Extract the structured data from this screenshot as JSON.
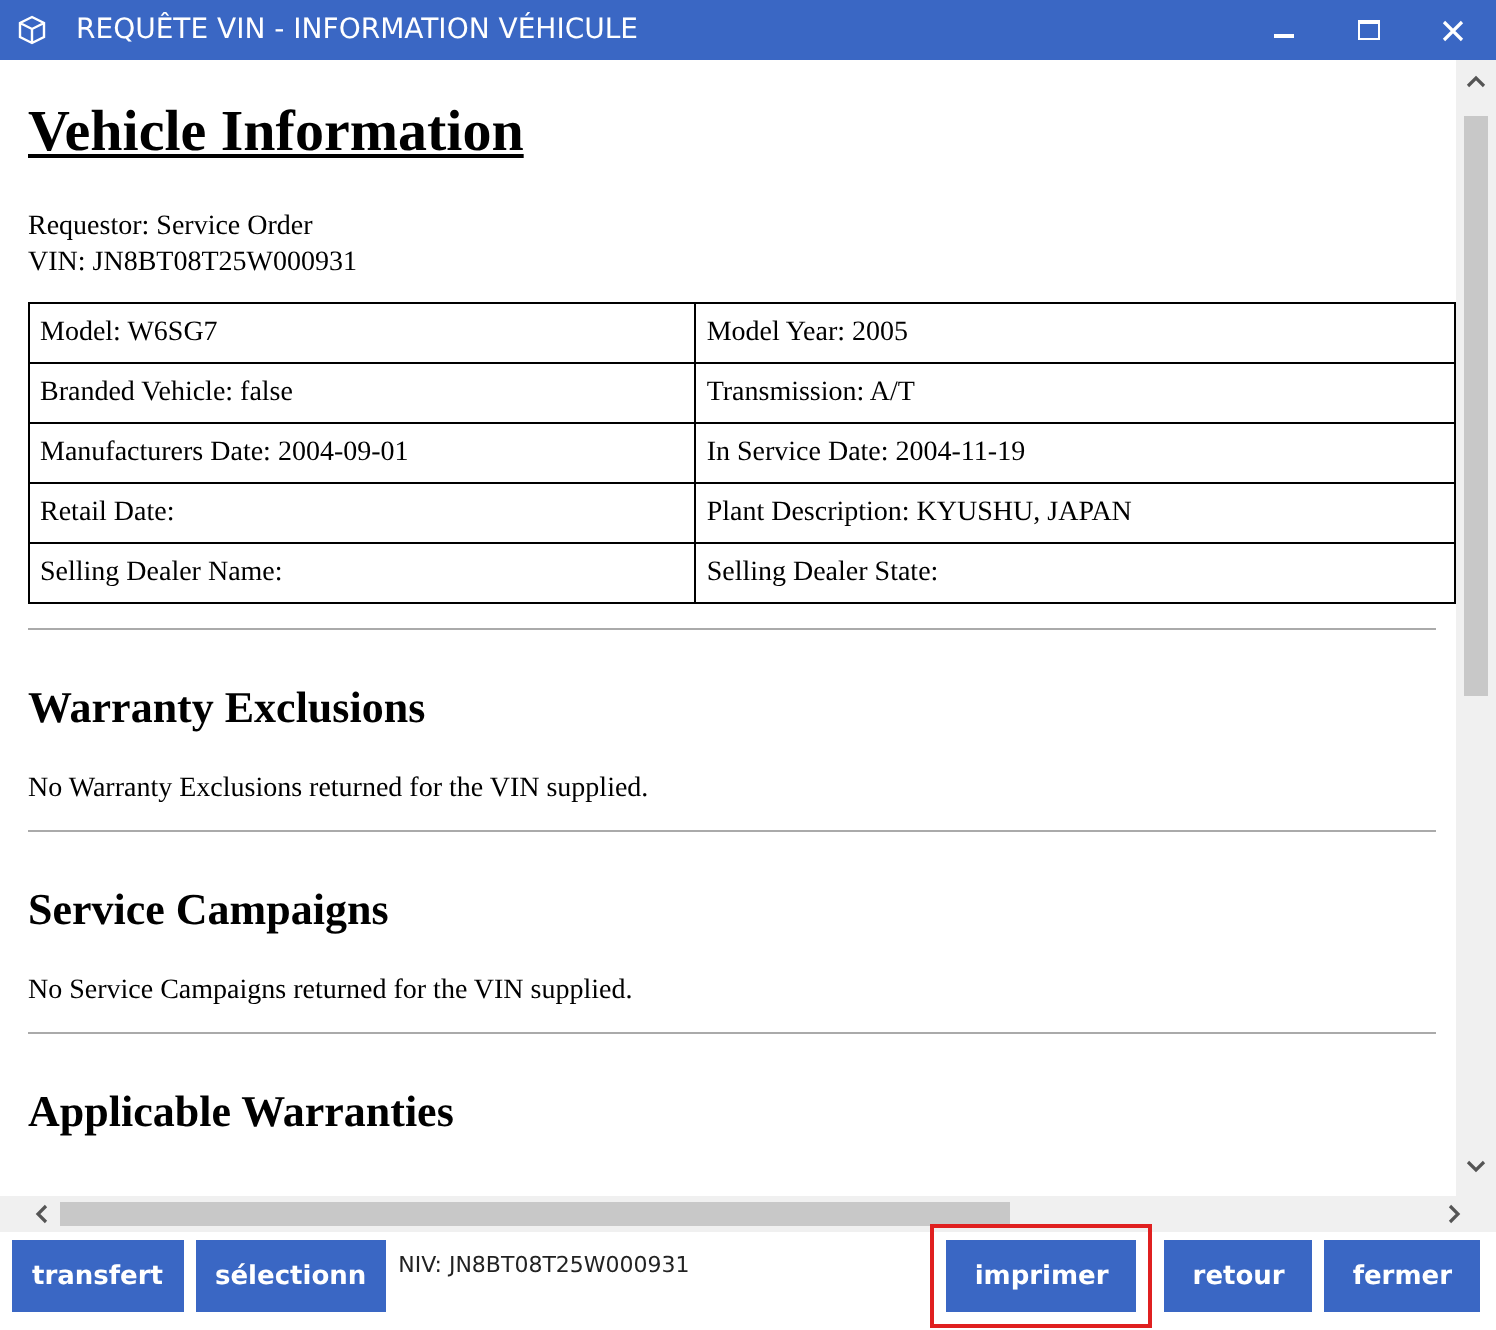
{
  "window": {
    "title": "REQUÊTE VIN - INFORMATION VÉHICULE"
  },
  "document": {
    "title": "Vehicle Information",
    "meta": [
      "Requestor: Service Order",
      "VIN: JN8BT08T25W000931"
    ],
    "table": {
      "rows": [
        [
          "Model: W6SG7",
          "Model Year: 2005"
        ],
        [
          "Branded Vehicle: false",
          "Transmission: A/T"
        ],
        [
          "Manufacturers Date: 2004-09-01",
          "In Service Date: 2004-11-19"
        ],
        [
          "Retail Date:",
          "Plant Description: KYUSHU, JAPAN"
        ],
        [
          "Selling Dealer Name:",
          "Selling Dealer State:"
        ]
      ]
    },
    "sections": [
      {
        "heading": "Warranty Exclusions",
        "text": "No Warranty Exclusions returned for the VIN supplied."
      },
      {
        "heading": "Service Campaigns",
        "text": "No Service Campaigns returned for the VIN supplied."
      },
      {
        "heading": "Applicable Warranties"
      }
    ]
  },
  "footer": {
    "left_buttons": [
      {
        "label": "transfert"
      },
      {
        "label": "sélectionn"
      }
    ],
    "niv": "NIV: JN8BT08T25W000931",
    "right_buttons": [
      {
        "label": "imprimer",
        "highlighted": true
      },
      {
        "label": "retour",
        "highlighted": false
      },
      {
        "label": "fermer",
        "highlighted": false
      }
    ]
  }
}
